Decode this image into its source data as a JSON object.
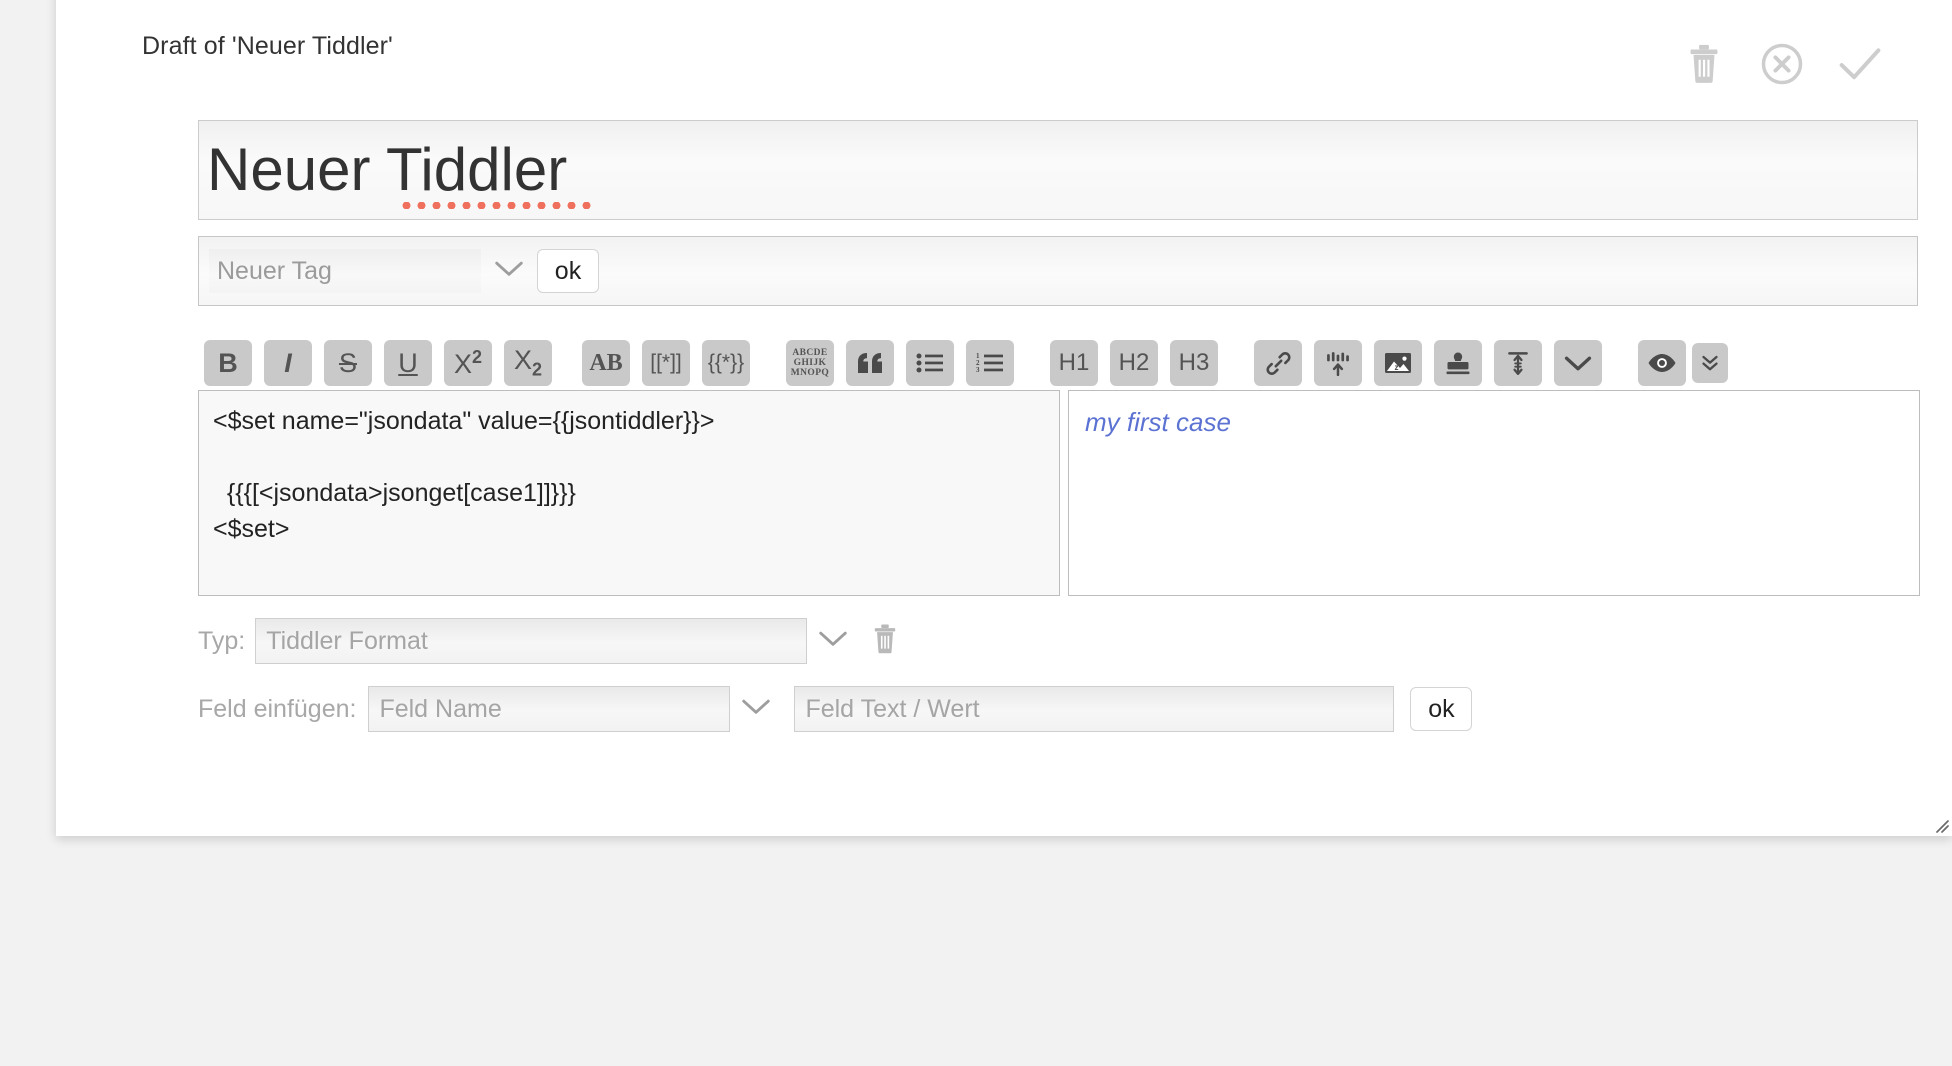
{
  "window": {
    "background_color": "#f2f2f2",
    "card_color": "#ffffff"
  },
  "header": {
    "draft_title": "Draft of 'Neuer Tiddler'",
    "actions": [
      {
        "name": "delete-tiddler-button",
        "icon": "trash-icon",
        "label": "Delete"
      },
      {
        "name": "cancel-edit-button",
        "icon": "cancel-circle-icon",
        "label": "Cancel"
      },
      {
        "name": "confirm-edit-button",
        "icon": "check-icon",
        "label": "Confirm"
      }
    ]
  },
  "title_field": {
    "value": "Neuer Tiddler",
    "spellcheck_underline": true,
    "spellcheck_color": "#f0705e"
  },
  "tag_row": {
    "placeholder": "Neuer Tag",
    "dropdown_icon": "chevron-down-icon",
    "ok_label": "ok"
  },
  "toolbar": {
    "buttons": [
      {
        "name": "bold-button",
        "icon": "bold-icon",
        "glyph": "B",
        "style": "bold"
      },
      {
        "name": "italic-button",
        "icon": "italic-icon",
        "glyph": "I",
        "style": "italic"
      },
      {
        "name": "strikethrough-button",
        "icon": "strikethrough-icon",
        "glyph": "S",
        "style": "strike"
      },
      {
        "name": "underline-button",
        "icon": "underline-icon",
        "glyph": "U",
        "style": "underline"
      },
      {
        "name": "superscript-button",
        "icon": "superscript-icon",
        "glyph": "X",
        "style": "sup",
        "affix": "2"
      },
      {
        "name": "subscript-button",
        "icon": "subscript-icon",
        "glyph": "X",
        "style": "sub",
        "affix": "2"
      },
      {
        "name": "monospace-button",
        "icon": "monospace-icon",
        "glyph": "AB",
        "style": "serifbold"
      },
      {
        "name": "wikilink-button",
        "icon": "wikilink-icon",
        "glyph": "[[*]]",
        "style": "plain"
      },
      {
        "name": "transclusion-button",
        "icon": "transclusion-icon",
        "glyph": "{{*}}",
        "style": "plain"
      },
      {
        "name": "monospace-block-button",
        "icon": "monospace-block-icon",
        "glyph": "ABCDE GHIJK MNOPQ",
        "style": "block"
      },
      {
        "name": "quote-button",
        "icon": "quote-icon",
        "glyph": "",
        "style": "svg"
      },
      {
        "name": "bulleted-list-button",
        "icon": "bulleted-list-icon",
        "glyph": "",
        "style": "svg"
      },
      {
        "name": "numbered-list-button",
        "icon": "numbered-list-icon",
        "glyph": "",
        "style": "svg"
      },
      {
        "name": "heading-1-button",
        "icon": "heading-1-icon",
        "glyph": "H1",
        "style": "hdr"
      },
      {
        "name": "heading-2-button",
        "icon": "heading-2-icon",
        "glyph": "H2",
        "style": "hdr"
      },
      {
        "name": "heading-3-button",
        "icon": "heading-3-icon",
        "glyph": "H3",
        "style": "hdr"
      },
      {
        "name": "link-button",
        "icon": "link-chain-icon",
        "glyph": "",
        "style": "svg"
      },
      {
        "name": "excise-button",
        "icon": "excise-icon",
        "glyph": "",
        "style": "svg"
      },
      {
        "name": "picture-button",
        "icon": "picture-icon",
        "glyph": "",
        "style": "svg"
      },
      {
        "name": "stamp-button",
        "icon": "stamp-icon",
        "glyph": "",
        "style": "svg"
      },
      {
        "name": "editor-height-button",
        "icon": "editor-height-icon",
        "glyph": "",
        "style": "svg"
      },
      {
        "name": "more-tools-button",
        "icon": "chevron-down-icon",
        "glyph": "",
        "style": "svg"
      },
      {
        "name": "preview-button",
        "icon": "eye-icon",
        "glyph": "",
        "style": "svg"
      },
      {
        "name": "preview-type-button",
        "icon": "double-chevron-down-icon",
        "glyph": "",
        "style": "svg"
      }
    ],
    "button_color": "#c9c9c9",
    "glyph_color": "#545454"
  },
  "editor": {
    "text": "<$set name=\"jsondata\" value={{jsontiddler}}>\n\n  {{{[<jsondata>jsonget[case1]]}}}\n<$set>",
    "resize_grip": "resize-grip-icon"
  },
  "preview": {
    "text": "my first case",
    "text_color": "#5c72d3"
  },
  "type_row": {
    "label": "Typ:",
    "placeholder": "Tiddler Format",
    "dropdown_icon": "chevron-down-icon",
    "delete_icon": "trash-icon"
  },
  "field_row": {
    "label": "Feld einfügen:",
    "name_placeholder": "Feld Name",
    "dropdown_icon": "chevron-down-icon",
    "value_placeholder": "Feld Text / Wert",
    "ok_label": "ok"
  }
}
